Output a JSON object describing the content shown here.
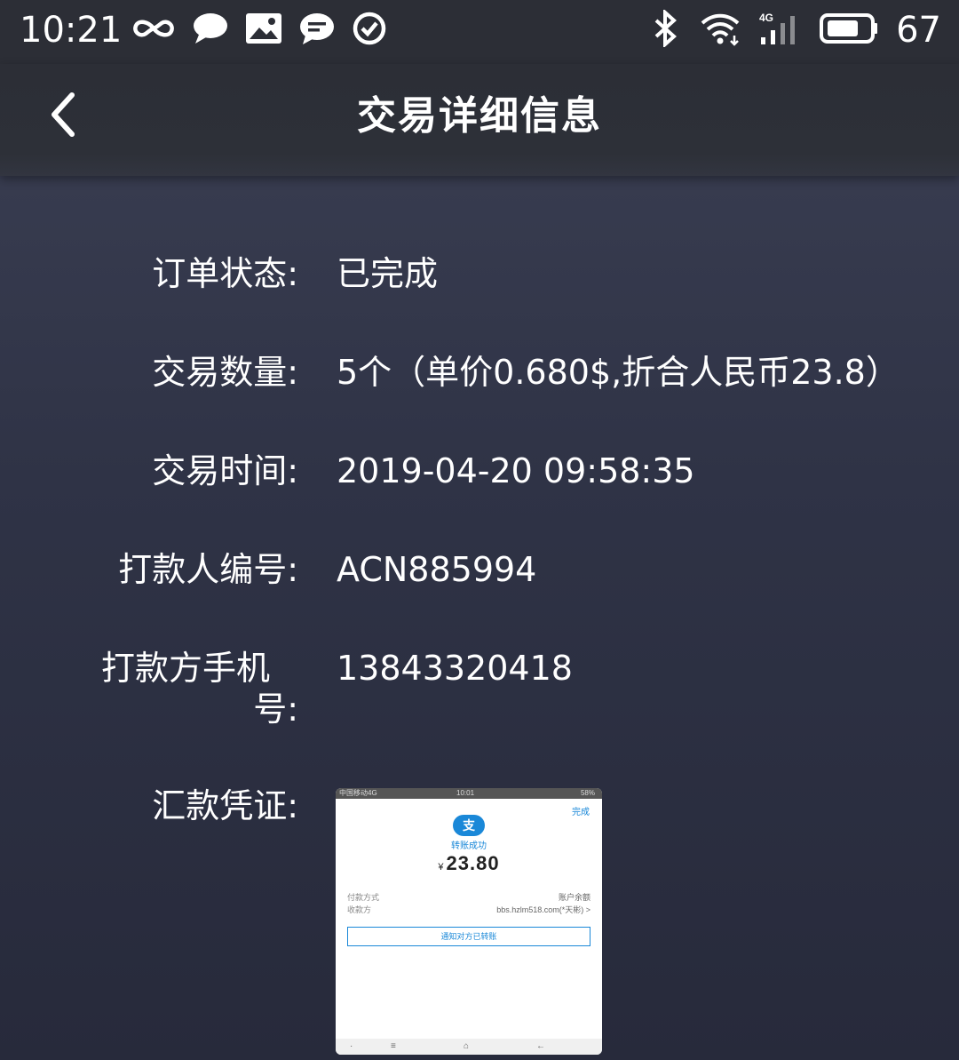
{
  "status_bar": {
    "time": "10:21",
    "battery": "67",
    "network": "4G"
  },
  "header": {
    "title": "交易详细信息"
  },
  "details": {
    "order_status_label": "订单状态:",
    "order_status_value": "已完成",
    "quantity_label": "交易数量:",
    "quantity_value": "5个（单价0.680$,折合人民币23.8）",
    "time_label": "交易时间:",
    "time_value": "2019-04-20 09:58:35",
    "payer_id_label": "打款人编号:",
    "payer_id_value": "ACN885994",
    "payer_phone_label_line1": "打款方手机",
    "payer_phone_label_line2": "号:",
    "payer_phone_value": "13843320418",
    "voucher_label": "汇款凭证:"
  },
  "receipt": {
    "carrier": "中国移动4G",
    "time": "10:01",
    "battery": "58%",
    "done": "完成",
    "logo": "支",
    "success": "转账成功",
    "currency": "¥",
    "amount": "23.80",
    "pay_method_label": "付款方式",
    "pay_method_value": "账户余额",
    "payee_label": "收款方",
    "payee_value": "bbs.hzlm518.com(*天彬) >",
    "notify_button": "通知对方已转账"
  },
  "colors": {
    "header_bg": "#2c2e36",
    "page_bg": "#2f3346",
    "text": "#ffffff",
    "alipay_blue": "#1a88d8"
  },
  "icons": {
    "back": "chevron-left-icon",
    "link": "infinity-icon",
    "chat": "chat-bubble-icon",
    "gallery": "image-icon",
    "message": "message-icon",
    "check": "check-circle-icon",
    "bluetooth": "bluetooth-icon",
    "wifi": "wifi-icon",
    "signal": "signal-icon",
    "battery": "battery-icon"
  }
}
